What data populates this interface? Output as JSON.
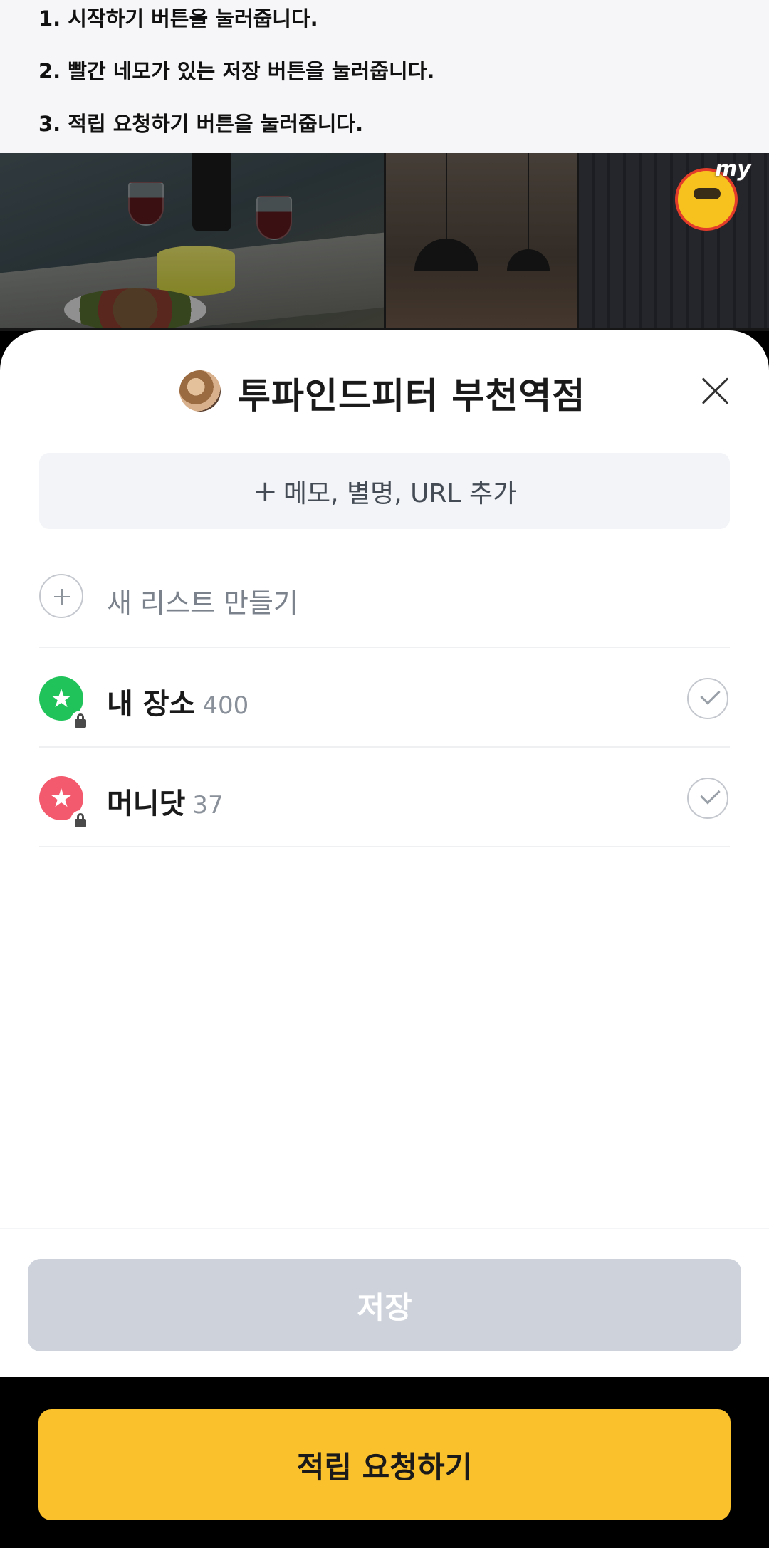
{
  "instructions": [
    "1. 시작하기 버튼을 눌러줍니다.",
    "2. 빨간 네모가 있는 저장 버튼을 눌러줍니다.",
    "3. 적립 요청하기 버튼을 눌러줍니다."
  ],
  "photos": {
    "logo_text": "my"
  },
  "sheet": {
    "place_title": "투파인드피터 부천역점",
    "memo_button": "메모, 별명, URL 추가",
    "memo_plus": "+",
    "new_list_label": "새 리스트 만들기",
    "lists": [
      {
        "name": "내 장소",
        "count": "400",
        "color": "#1fc35a",
        "icon": "star-icon"
      },
      {
        "name": "머니닷",
        "count": "37",
        "color": "#f45a6d",
        "icon": "star-icon"
      }
    ],
    "save_button": "저장"
  },
  "bottom": {
    "reward_button": "적립 요청하기"
  },
  "colors": {
    "save_disabled": "#cdd2db",
    "reward_yellow": "#fbc12d"
  }
}
